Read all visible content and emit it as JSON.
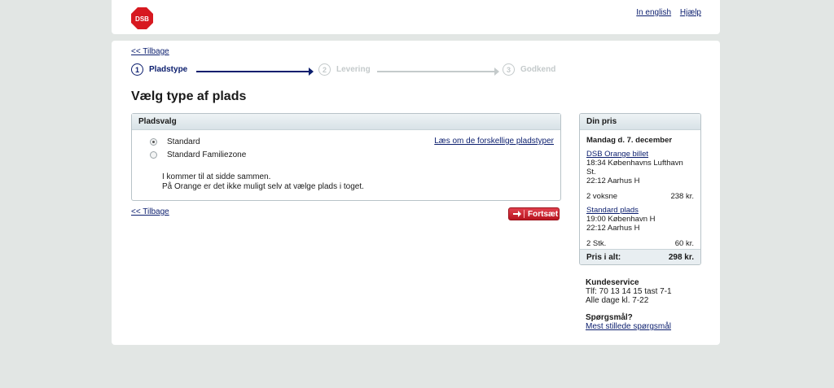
{
  "header": {
    "logo_text": "DSB",
    "links": {
      "english": "In english",
      "help": "Hjælp"
    }
  },
  "nav": {
    "back_top": "<< Tilbage",
    "back_bottom": "<< Tilbage"
  },
  "steps": [
    {
      "number": "1",
      "label": "Pladstype",
      "state": "active"
    },
    {
      "number": "2",
      "label": "Levering",
      "state": "inactive"
    },
    {
      "number": "3",
      "label": "Godkend",
      "state": "inactive"
    }
  ],
  "page_title": "Vælg type af plads",
  "panel": {
    "title": "Pladsvalg",
    "options": [
      {
        "label": "Standard",
        "checked": true
      },
      {
        "label": "Standard Familiezone",
        "checked": false
      }
    ],
    "link": "Læs om de forskellige pladstyper",
    "info_line1": "I kommer til at sidde sammen.",
    "info_line2": "På Orange er det ikke muligt selv at vælge plads i toget."
  },
  "continue_label": "Fortsæt",
  "price": {
    "title": "Din pris",
    "date": "Mandag d. 7. december",
    "ticket": {
      "link": "DSB Orange billet",
      "line1": "18:34 Københavns Lufthavn",
      "line2": "St.",
      "line3": "22:12 Aarhus H",
      "qty": "2 voksne",
      "amount": "238 kr."
    },
    "seat": {
      "link": "Standard plads",
      "line1": "19:00 København H",
      "line2": "22:12 Aarhus H",
      "qty": "2 Stk.",
      "amount": "60 kr."
    },
    "total_label": "Pris i alt:",
    "total_amount": "298 kr."
  },
  "service": {
    "title": "Kundeservice",
    "phone": "Tlf: 70 13 14 15 tast 7-1",
    "hours": "Alle dage kl. 7-22"
  },
  "faq": {
    "title": "Spørgsmål?",
    "link": "Mest stillede spørgsmål"
  },
  "colors": {
    "brand_red": "#d71920",
    "nav_blue": "#0b1e6e",
    "background": "#e2e6e4"
  }
}
